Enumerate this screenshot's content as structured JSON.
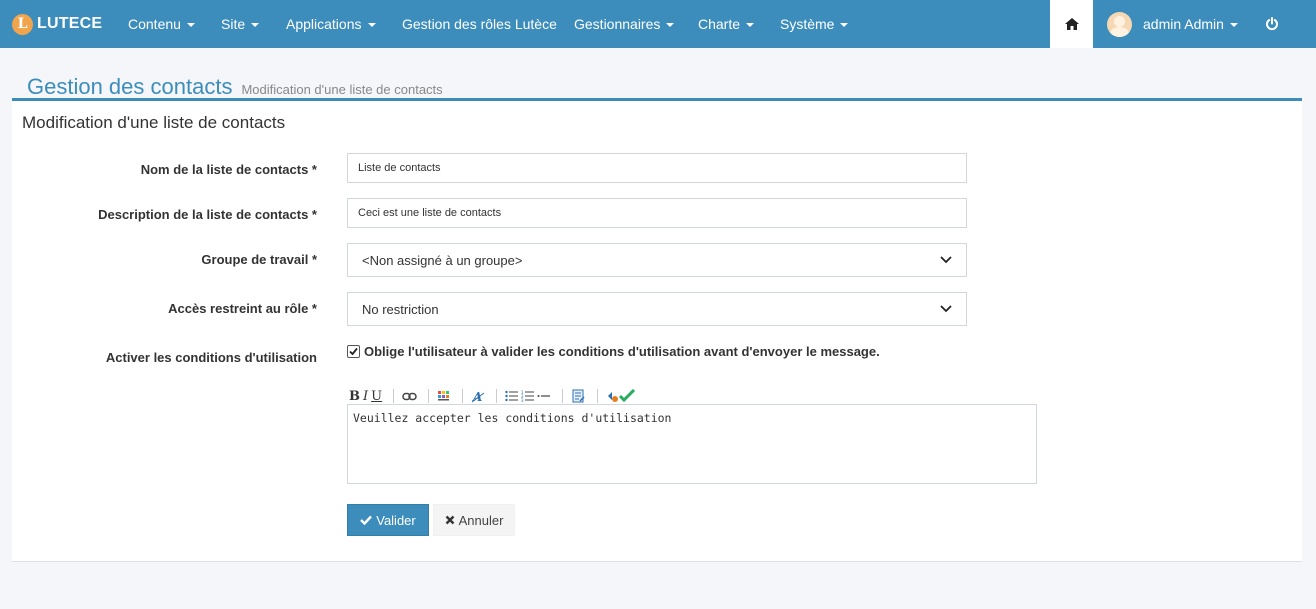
{
  "navbar": {
    "brand_logo_letter": "L",
    "brand_text": "LUTECE",
    "items": [
      {
        "label": "Contenu",
        "dropdown": true
      },
      {
        "label": "Site",
        "dropdown": true
      },
      {
        "label": "Applications",
        "dropdown": true
      },
      {
        "label": "Gestion des rôles Lutèce",
        "dropdown": false
      },
      {
        "label": "Gestionnaires",
        "dropdown": true
      },
      {
        "label": "Charte",
        "dropdown": true
      },
      {
        "label": "Système",
        "dropdown": true
      }
    ],
    "home_icon": "home-icon",
    "user_name": "admin Admin",
    "power_icon": "power-icon"
  },
  "header": {
    "title": "Gestion des contacts",
    "subtitle": "Modification d'une liste de contacts"
  },
  "form": {
    "box_title": "Modification d'une liste de contacts",
    "name_label": "Nom de la liste de contacts *",
    "name_value": "Liste de contacts",
    "description_label": "Description de la liste de contacts *",
    "description_value": "Ceci est une liste de contacts",
    "workgroup_label": "Groupe de travail *",
    "workgroup_value": "<Non assigné à un groupe>",
    "role_label": "Accès restreint au rôle *",
    "role_value": "No restriction",
    "tos_label": "Activer les conditions d'utilisation",
    "tos_checked": true,
    "tos_checkbox_label": "Oblige l'utilisateur à valider les conditions d'utilisation avant d'envoyer le message.",
    "editor_text": "Veuillez accepter les conditions d'utilisation",
    "submit_label": "Valider",
    "cancel_label": "Annuler"
  },
  "colors": {
    "accent": "#3c8dbc",
    "navbar_text": "#ffffff"
  }
}
